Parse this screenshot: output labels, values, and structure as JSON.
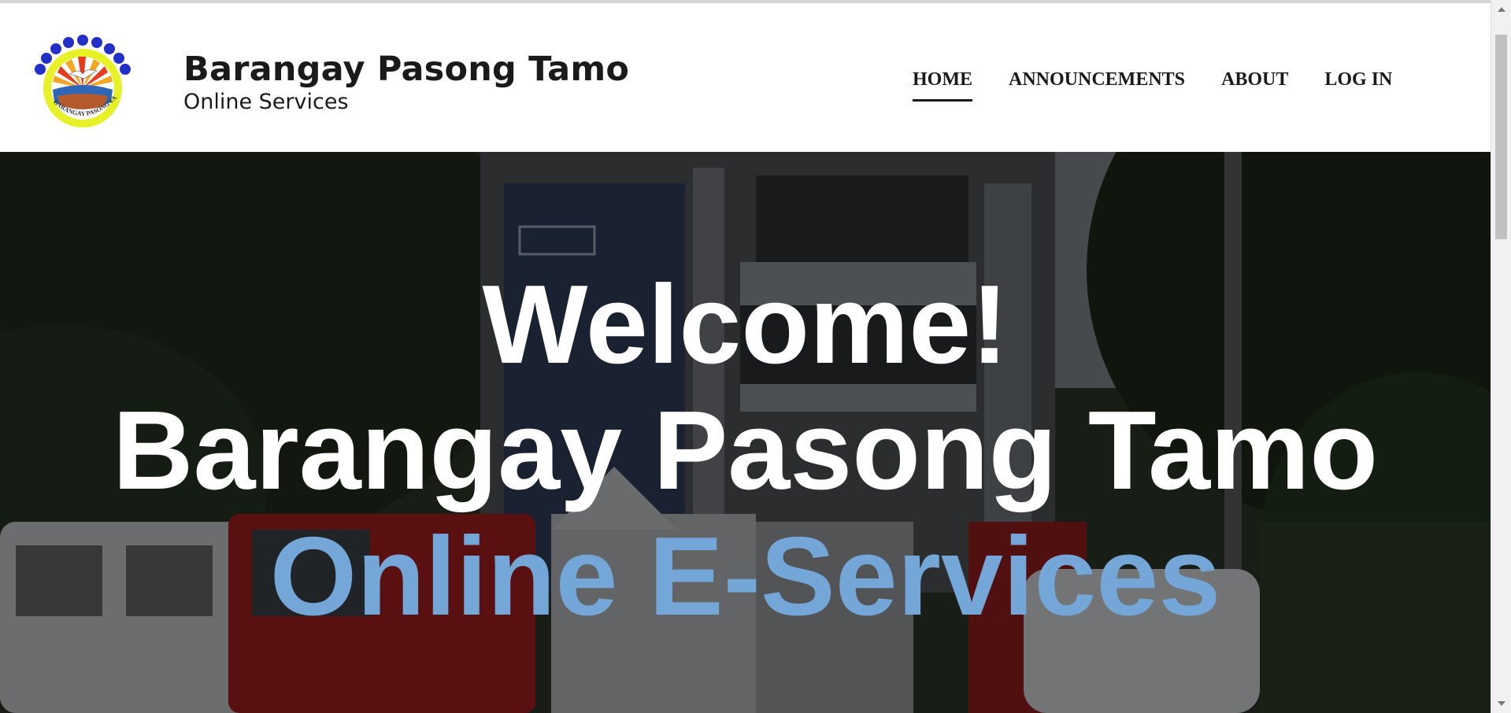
{
  "brand": {
    "title": "Barangay Pasong Tamo",
    "subtitle": "Online Services",
    "logo_icon": "barangay-seal-icon",
    "logo_text": "BARANGAY PASONG TAMO"
  },
  "nav": {
    "items": [
      {
        "label": "HOME",
        "active": true
      },
      {
        "label": "ANNOUNCEMENTS",
        "active": false
      },
      {
        "label": "ABOUT",
        "active": false
      },
      {
        "label": "LOG IN",
        "active": false
      }
    ]
  },
  "hero": {
    "line1": "Welcome!",
    "line2": "Barangay Pasong Tamo",
    "line3": "Online E-Services",
    "accent_color": "#74a6d8",
    "background": "barangay-hall-photo"
  }
}
